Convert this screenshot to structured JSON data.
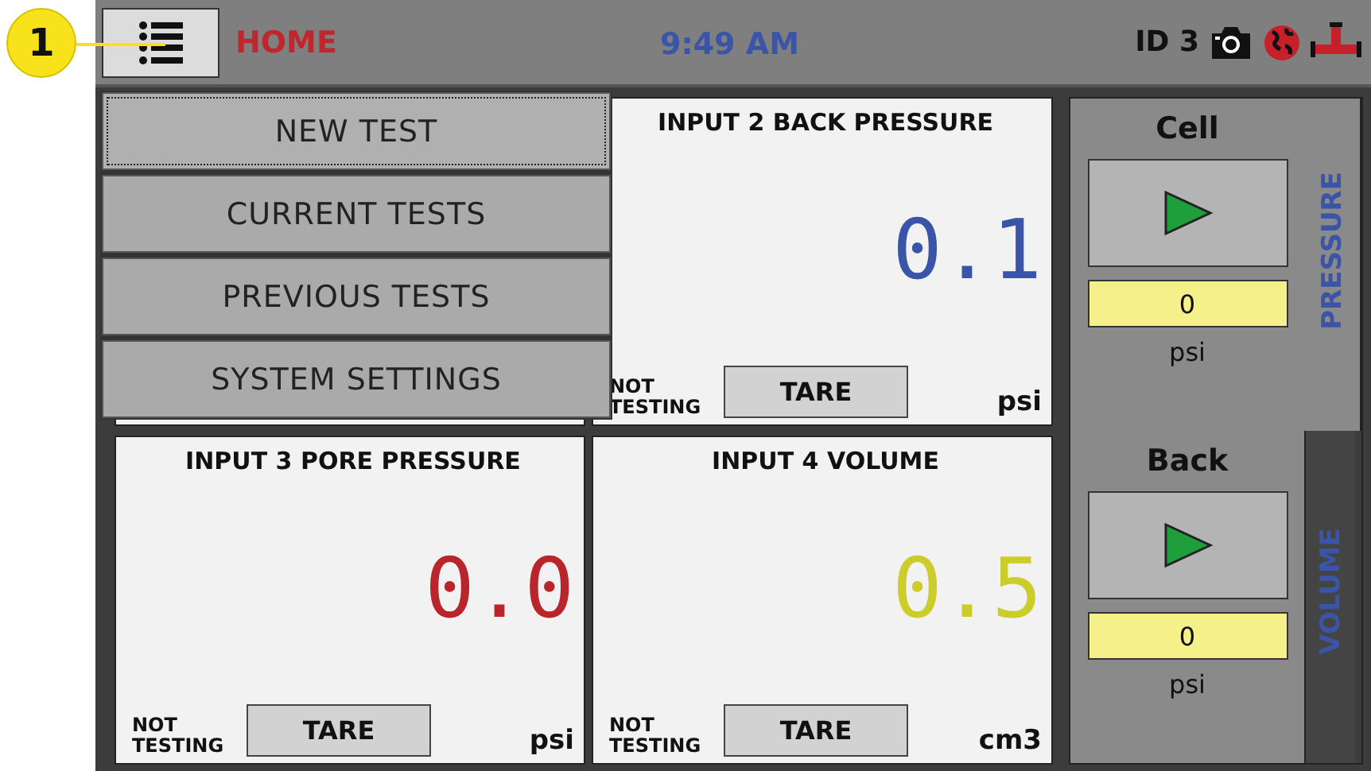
{
  "annotation": {
    "label": "1"
  },
  "top_bar": {
    "title": "HOME",
    "time": "9:49 AM",
    "device_id": "ID 3"
  },
  "menu": {
    "items": [
      {
        "label": "NEW TEST",
        "selected": true
      },
      {
        "label": "CURRENT TESTS",
        "selected": false
      },
      {
        "label": "PREVIOUS TESTS",
        "selected": false
      },
      {
        "label": "SYSTEM SETTINGS",
        "selected": false
      }
    ]
  },
  "inputs": [
    {
      "title": "INPUT 2 BACK PRESSURE",
      "value": "0.1",
      "color": "#3a55a8",
      "status": "NOT TESTING",
      "button": "TARE",
      "unit": "psi"
    },
    {
      "title": "INPUT 3 PORE PRESSURE",
      "value": "0.0",
      "color": "#b8262c",
      "status": "NOT TESTING",
      "button": "TARE",
      "unit": "psi"
    },
    {
      "title": "INPUT 4 VOLUME",
      "value": "0.5",
      "color": "#cccc2a",
      "status": "NOT TESTING",
      "button": "TARE",
      "unit": "cm3"
    }
  ],
  "side_panel": {
    "tabs": [
      {
        "label": "PRESSURE",
        "selected": true
      },
      {
        "label": "VOLUME",
        "selected": false
      }
    ],
    "controls": [
      {
        "label": "Cell",
        "value": "0",
        "unit": "psi"
      },
      {
        "label": "Back",
        "value": "0",
        "unit": "psi"
      }
    ]
  }
}
